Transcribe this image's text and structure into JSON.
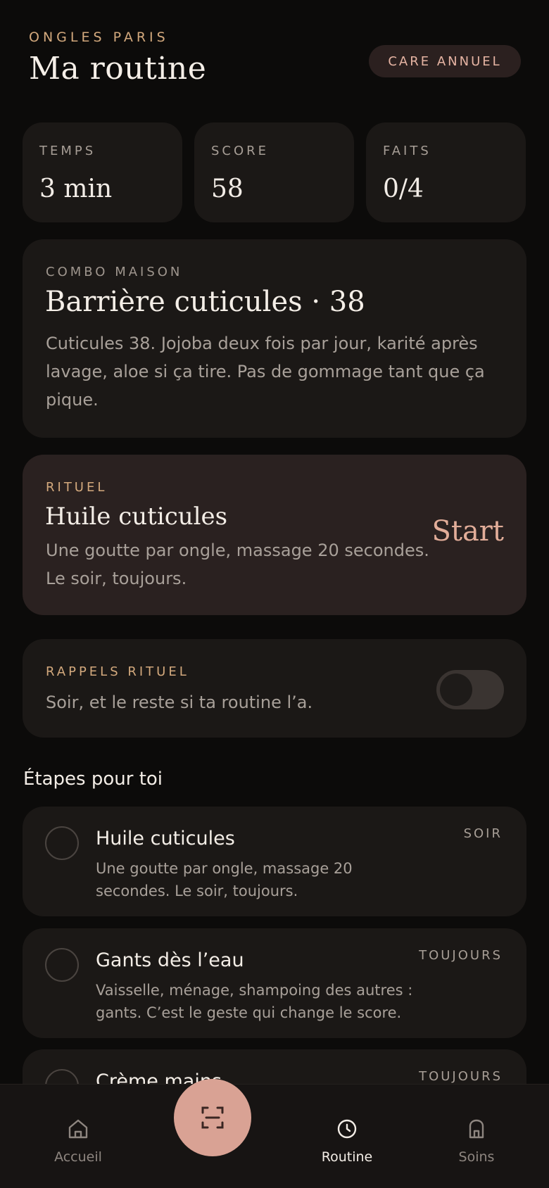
{
  "header": {
    "brand": "ONGLES PARIS",
    "title": "Ma routine",
    "plan_badge": "CARE ANNUEL"
  },
  "stats": [
    {
      "label": "TEMPS",
      "value": "3 min"
    },
    {
      "label": "SCORE",
      "value": "58"
    },
    {
      "label": "FAITS",
      "value": "0/4"
    }
  ],
  "combo": {
    "label": "COMBO MAISON",
    "title": "Barrière cuticules · 38",
    "body": "Cuticules 38. Jojoba deux fois par jour, karité après lavage, aloe si ça tire. Pas de gommage tant que ça pique."
  },
  "ritual": {
    "label": "RITUEL",
    "title": "Huile cuticules",
    "body": "Une goutte par ongle, massage 20 secondes. Le soir, toujours.",
    "start_label": "Start"
  },
  "reminders": {
    "label": "RAPPELS RITUEL",
    "body": "Soir, et le reste si ta routine l’a.",
    "enabled": false
  },
  "steps_section": {
    "title": "Étapes pour toi",
    "items": [
      {
        "title": "Huile cuticules",
        "desc": "Une goutte par ongle, massage 20 secondes. Le soir, toujours.",
        "tag": "SOIR"
      },
      {
        "title": "Gants dès l’eau",
        "desc": "Vaisselle, ménage, shampoing des autres : gants. C’est le geste qui change le score.",
        "tag": "TOUJOURS"
      },
      {
        "title": "Crème mains",
        "desc": "",
        "tag": "TOUJOURS"
      }
    ]
  },
  "nav": {
    "items": [
      {
        "label": "Accueil",
        "icon": "home-icon"
      },
      {
        "label": "Routine",
        "icon": "clock-icon",
        "active": true
      },
      {
        "label": "Soins",
        "icon": "care-icon"
      }
    ],
    "scan_icon": "scan-icon"
  },
  "colors": {
    "background": "#0c0b0a",
    "card": "#1b1816",
    "card_highlight": "#2a2120",
    "gold": "#d3a97d",
    "rose": "#e2ad99",
    "fab": "#d9a294"
  }
}
